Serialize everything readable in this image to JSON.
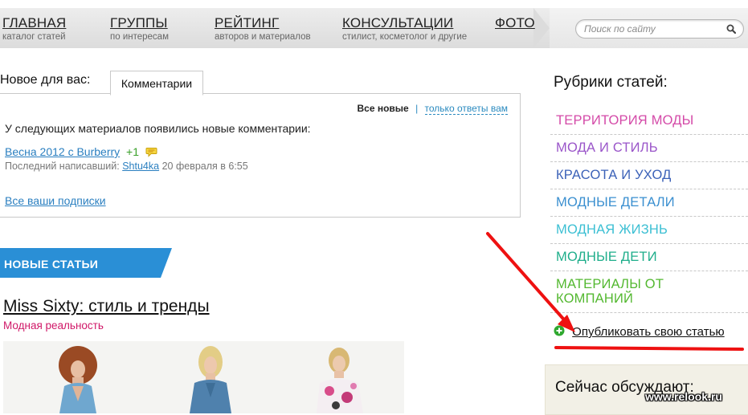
{
  "nav": {
    "items": [
      {
        "title": "ГЛАВНАЯ",
        "subtitle": "каталог статей"
      },
      {
        "title": "ГРУППЫ",
        "subtitle": "по интересам"
      },
      {
        "title": "РЕЙТИНГ",
        "subtitle": "авторов и материалов"
      },
      {
        "title": "КОНСУЛЬТАЦИИ",
        "subtitle": "стилист, косметолог и другие"
      },
      {
        "title": "ФОТО",
        "subtitle": ""
      }
    ]
  },
  "search": {
    "placeholder": "Поиск по сайту",
    "icon": "search-icon"
  },
  "updates": {
    "label": "Новое для вас:",
    "tab": "Комментарии",
    "filter_all": "Все новые",
    "filter_separator": "|",
    "filter_replies": "только ответы вам",
    "notice": "У следующих материалов появились новые комментарии:",
    "item": {
      "link": "Весна 2012 с Burberry",
      "count": "+1",
      "icon": "comment-icon"
    },
    "last_writer_label": "Последний написавший:",
    "last_writer_user": "Shtu4ka",
    "last_writer_date": "20 февраля в 6:55",
    "subscriptions": "Все ваши подписки"
  },
  "new_articles": {
    "heading": "НОВЫЕ СТАТЬИ",
    "article_title": "Miss Sixty: стиль и тренды",
    "article_category": "Модная реальность"
  },
  "sidebar": {
    "title": "Рубрики статей:",
    "categories": [
      {
        "label": "ТЕРРИТОРИЯ МОДЫ",
        "color": "#d44aa8"
      },
      {
        "label": "МОДА И СТИЛЬ",
        "color": "#9a55c9"
      },
      {
        "label": "КРАСОТА И УХОД",
        "color": "#3c62b8"
      },
      {
        "label": "МОДНЫЕ ДЕТАЛИ",
        "color": "#3a8fd0"
      },
      {
        "label": "МОДНАЯ ЖИЗНЬ",
        "color": "#3bbfd3"
      },
      {
        "label": "МОДНЫЕ ДЕТИ",
        "color": "#1fae8b"
      },
      {
        "label": "МАТЕРИАЛЫ ОТ КОМПАНИЙ",
        "color": "#53b830"
      }
    ],
    "publish": "Опубликовать свою статью",
    "discussing_title": "Сейчас обсуждают:"
  },
  "watermark": "www.relook.ru",
  "colors": {
    "ribbon": "#2a8fd6",
    "annotation": "#ee1111"
  }
}
